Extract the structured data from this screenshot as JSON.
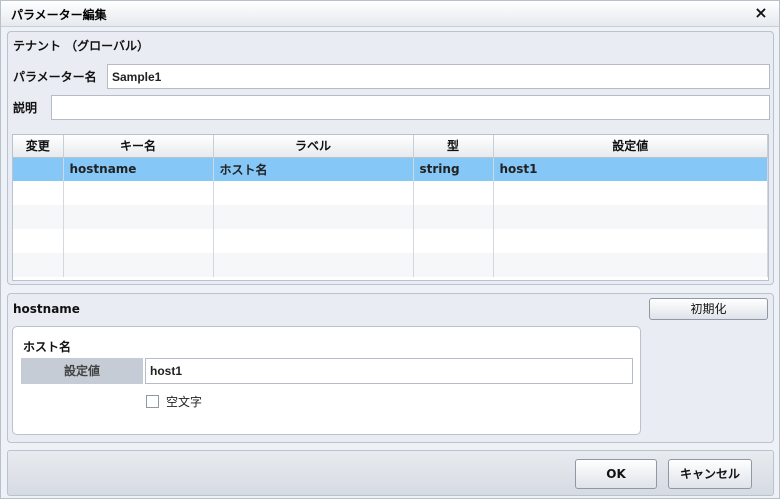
{
  "window": {
    "title": "パラメーター編集",
    "close_icon": "×"
  },
  "top": {
    "tenant_label": "テナント （グローバル）",
    "param_name_label": "パラメーター名",
    "param_name_value": "Sample1",
    "description_label": "説明",
    "description_value": ""
  },
  "grid": {
    "headers": [
      "変更",
      "キー名",
      "ラベル",
      "型",
      "設定値"
    ],
    "rows": [
      {
        "changed": "",
        "key": "hostname",
        "label": "ホスト名",
        "type": "string",
        "value": "host1"
      }
    ]
  },
  "detail": {
    "title": "hostname",
    "reset_button": "初期化",
    "group_title": "ホスト名",
    "field_label": "設定値",
    "field_value": "host1",
    "empty_string_label": "空文字",
    "empty_string_checked": false
  },
  "footer": {
    "ok_label": "OK",
    "cancel_label": "キャンセル"
  }
}
